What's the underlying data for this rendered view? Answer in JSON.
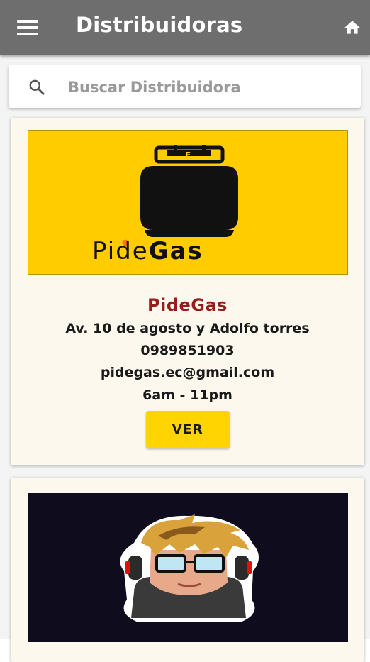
{
  "appbar": {
    "title": "Distribuidoras",
    "menu_icon": "hamburger-menu-icon",
    "home_icon": "home-icon",
    "background": "#6e6e6e"
  },
  "search": {
    "placeholder": "Buscar Distribuidora",
    "value": "",
    "icon": "search-icon"
  },
  "distributors": [
    {
      "name": "PideGas",
      "logo_text": "PideGas",
      "address": "Av. 10 de agosto y Adolfo torres",
      "phone": "0989851903",
      "email": "pidegas.ec@gmail.com",
      "hours": "6am - 11pm",
      "button_label": "VER",
      "logo_bg": "#ffcc00"
    },
    {
      "logo_description": "gamer-avatar-logo",
      "logo_bg": "#0f0c1e"
    }
  ],
  "colors": {
    "title_red": "#9a1b1b",
    "button_yellow": "#ffd400",
    "card_bg": "#fdf8ee"
  }
}
